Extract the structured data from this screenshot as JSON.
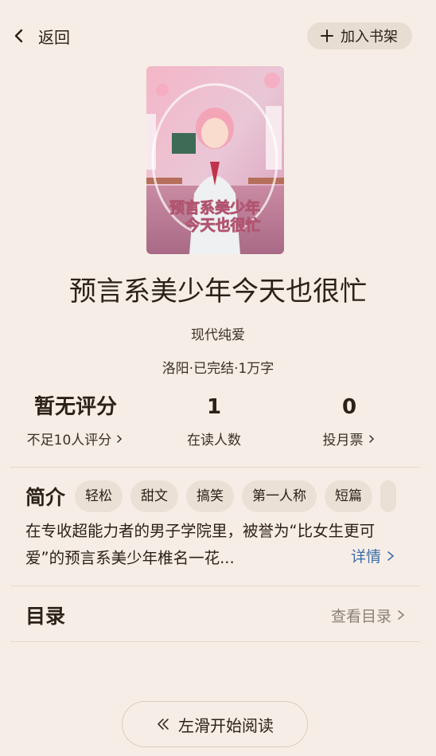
{
  "header": {
    "back_label": "返回",
    "shelf_label": "加入书架"
  },
  "book": {
    "cover_title_line1": "预言系美少年",
    "cover_title_line2": "今天也很忙",
    "title": "预言系美少年今天也很忙",
    "genre": "现代纯爱",
    "meta": "洛阳·已完结·1万字"
  },
  "stats": [
    {
      "value": "暂无评分",
      "label": "不足10人评分"
    },
    {
      "value": "1",
      "label": "在读人数"
    },
    {
      "value": "0",
      "label": "投月票"
    }
  ],
  "intro": {
    "label": "简介",
    "tags": [
      "轻松",
      "甜文",
      "搞笑",
      "第一人称",
      "短篇"
    ],
    "description": "在专收超能力者的男子学院里，被誉为“比女生更可爱”的预言系美少年椎名一花...",
    "more_label": "详情"
  },
  "toc": {
    "title": "目录",
    "link_label": "查看目录"
  },
  "footer": {
    "start_label": "左滑开始阅读"
  },
  "colors": {
    "background": "#f6eee6",
    "link": "#3e6ea8",
    "tag_bg": "#ebe0d5"
  }
}
